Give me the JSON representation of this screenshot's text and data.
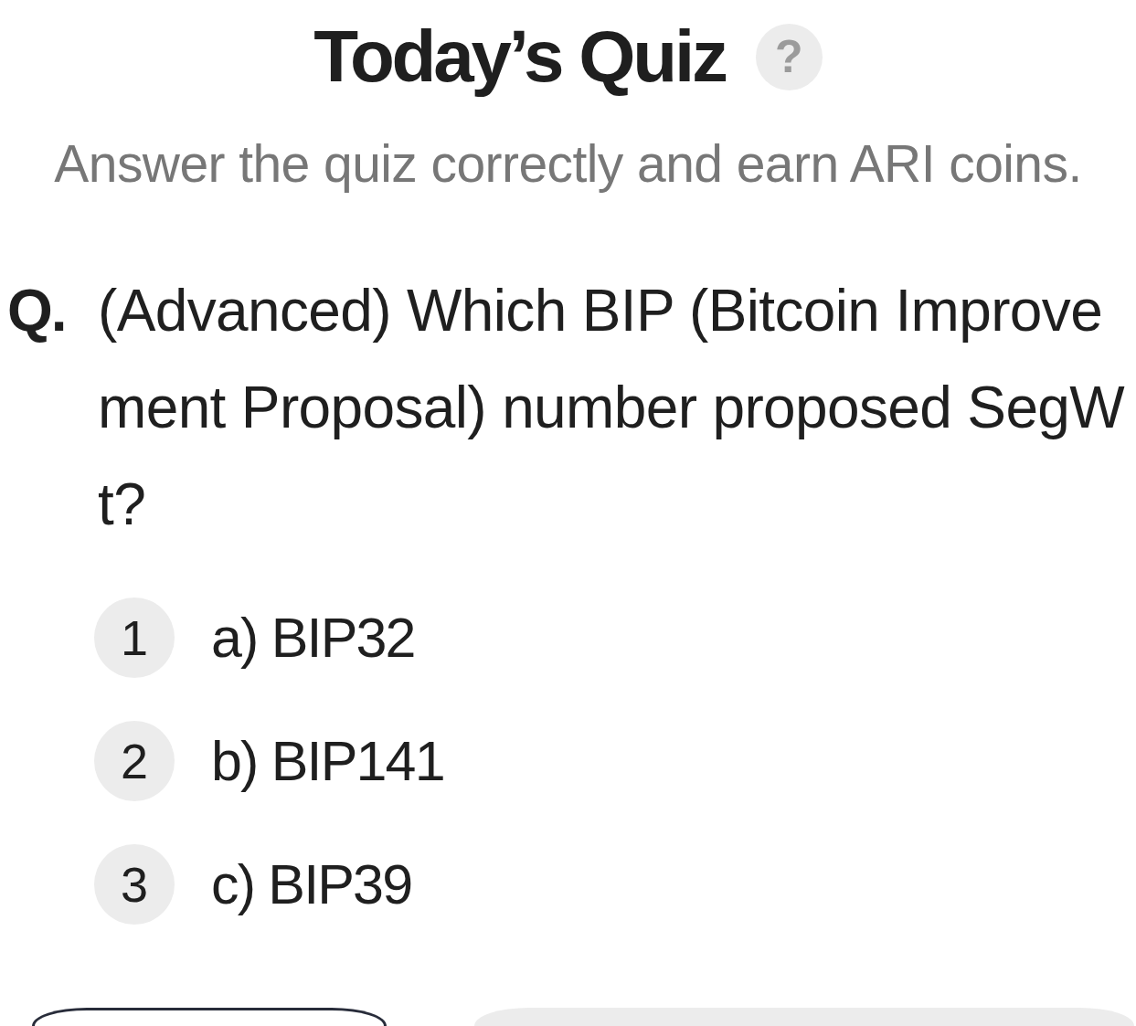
{
  "header": {
    "title": "Today’s Quiz",
    "help": "?",
    "subtitle": "Answer the quiz correctly and earn ARI coins."
  },
  "question": {
    "prefix": "Q.",
    "text": "(Advanced) Which BIP (Bitcoin Improvement Proposal) number proposed SegWt?"
  },
  "options": [
    {
      "number": "1",
      "label": "a) BIP32"
    },
    {
      "number": "2",
      "label": "b) BIP141"
    },
    {
      "number": "3",
      "label": "c) BIP39"
    }
  ],
  "buttons": [
    {
      "kind": "outline"
    },
    {
      "kind": "filled"
    }
  ]
}
